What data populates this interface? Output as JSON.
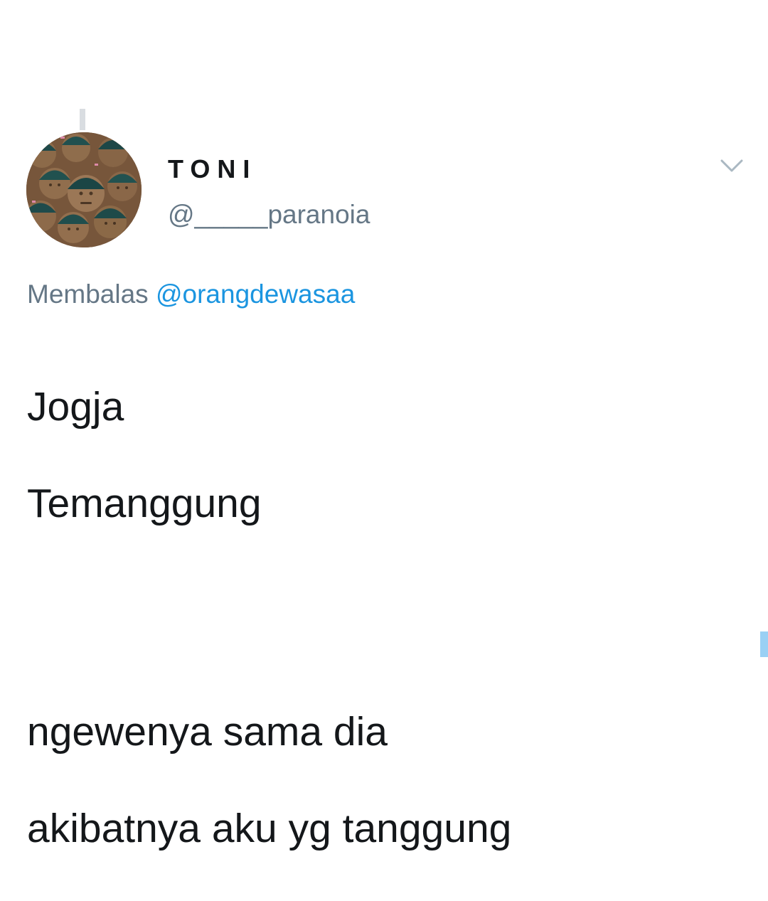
{
  "tweet": {
    "display_name": "TONI",
    "handle": "@_____paranoia",
    "reply_prefix": "Membalas",
    "reply_mention": "@orangdewasaa",
    "lines": [
      "Jogja",
      "Temanggung",
      "ngewenya sama dia",
      "akibatnya aku yg tanggung"
    ]
  },
  "icons": {
    "menu_caret": "chevron-down-icon"
  },
  "colors": {
    "text_primary": "#14171a",
    "text_secondary": "#657786",
    "mention": "#1b95e0",
    "scroll_marker": "#9ad0f4",
    "thread_line": "#d9dde1"
  }
}
